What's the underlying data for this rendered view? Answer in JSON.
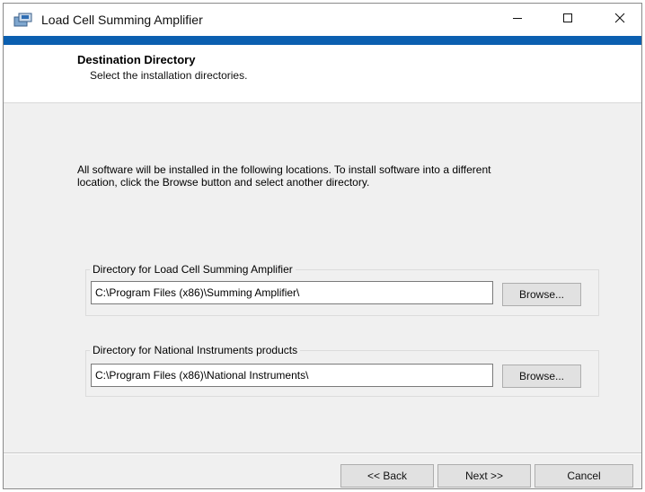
{
  "window": {
    "title": "Load Cell Summing Amplifier",
    "app_icon": "installer-icon",
    "controls": [
      "minimize-icon",
      "maximize-icon",
      "close-icon"
    ]
  },
  "header": {
    "title": "Destination Directory",
    "subtitle": "Select the installation directories."
  },
  "description": "All software will be installed in the following locations. To install software into a different location, click the Browse button and select another directory.",
  "directories": [
    {
      "label": "Directory for Load Cell Summing Amplifier",
      "value": "C:\\Program Files (x86)\\Summing Amplifier\\",
      "browse_label": "Browse..."
    },
    {
      "label": "Directory for National Instruments products",
      "value": "C:\\Program Files (x86)\\National Instruments\\",
      "browse_label": "Browse..."
    }
  ],
  "footer": {
    "back_label": "<< Back",
    "next_label": "Next >>",
    "cancel_label": "Cancel"
  },
  "colors": {
    "accent": "#0b5fb0",
    "dialog_bg": "#f0f0f0",
    "button_bg": "#e1e1e1"
  }
}
